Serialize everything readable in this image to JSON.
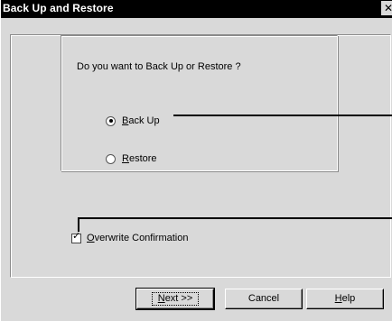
{
  "window": {
    "title": "Back Up and Restore",
    "close_glyph": "✕"
  },
  "group": {
    "legend": "Do you want to Back Up or Restore ?"
  },
  "options": [
    {
      "mnemonic": "B",
      "rest": "ack Up",
      "selected": true
    },
    {
      "mnemonic": "R",
      "rest": "estore",
      "selected": false
    }
  ],
  "overwrite": {
    "mnemonic": "O",
    "rest": "verwrite Confirmation",
    "checked": true,
    "check_glyph": "✓"
  },
  "buttons": {
    "next": {
      "mnemonic": "N",
      "rest": "ext >>"
    },
    "cancel": {
      "label": "Cancel"
    },
    "help": {
      "mnemonic": "H",
      "rest": "elp"
    }
  }
}
